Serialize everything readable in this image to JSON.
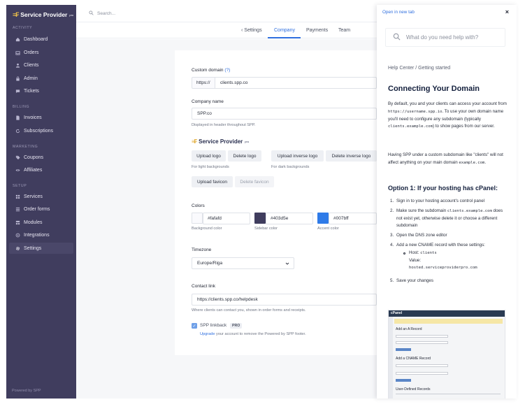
{
  "sidebar": {
    "brand": "Service Provider",
    "brand_mark": "≡₣",
    "brand_tm": "pro",
    "sections": [
      "ACTIVITY",
      "BILLING",
      "MARKETING",
      "SETUP"
    ],
    "items": [
      {
        "label": "Dashboard",
        "icon": "home-icon"
      },
      {
        "label": "Orders",
        "icon": "inbox-icon"
      },
      {
        "label": "Clients",
        "icon": "user-icon"
      },
      {
        "label": "Admin",
        "icon": "lock-icon"
      },
      {
        "label": "Tickets",
        "icon": "chat-icon"
      },
      {
        "label": "Invoices",
        "icon": "file-icon"
      },
      {
        "label": "Subscriptions",
        "icon": "refresh-icon"
      },
      {
        "label": "Coupons",
        "icon": "tag-icon"
      },
      {
        "label": "Affiliates",
        "icon": "eye-icon"
      },
      {
        "label": "Services",
        "icon": "grid-icon"
      },
      {
        "label": "Order forms",
        "icon": "list-icon"
      },
      {
        "label": "Modules",
        "icon": "modules-icon"
      },
      {
        "label": "Integrations",
        "icon": "plug-icon"
      },
      {
        "label": "Settings",
        "icon": "gear-icon"
      }
    ],
    "active": "Settings",
    "powered": "Powered by SPP"
  },
  "topbar": {
    "search_placeholder": "Search..."
  },
  "subnav": {
    "back": "‹ Settings",
    "tabs": [
      "Company",
      "Payments",
      "Team"
    ],
    "active": "Company"
  },
  "form": {
    "custom_domain_label": "Custom domain",
    "custom_domain_help": "(?)",
    "domain_prefix": "https://",
    "domain_value": "clients.spp.co",
    "company_name_label": "Company name",
    "company_name_value": "SPP.co",
    "company_name_hint": "Displayed in header throughout SPP.",
    "logo_preview_text": "Service Provider",
    "logo_preview_mark": "≡₣",
    "logo_preview_tm": "pro",
    "upload_logo": "Upload logo",
    "delete_logo": "Delete logo",
    "upload_inverse_logo": "Upload inverse logo",
    "delete_inverse_logo": "Delete inverse logo",
    "light_bg_hint": "For light backgrounds",
    "dark_bg_hint": "For dark backgrounds",
    "upload_favicon": "Upload favicon",
    "delete_favicon": "Delete favicon",
    "colors_label": "Colors",
    "background_color": "#fafafd",
    "background_color_label": "Background color",
    "sidebar_color": "#403d5e",
    "sidebar_color_label": "Sidebar color",
    "accent_color": "#007bff",
    "accent_color_label": "Accent color",
    "timezone_label": "Timezone",
    "timezone_value": "Europe/Riga",
    "contact_link_label": "Contact link",
    "contact_link_value": "https://clients.spp.co/helpdesk",
    "contact_link_hint": "Where clients can contact you, shown in order forms and receipts.",
    "linkback_label": "SPP linkback",
    "linkback_badge": "PRO",
    "linkback_upgrade": "Upgrade",
    "linkback_hint": " your account to remove the Powered by SPP footer."
  },
  "help": {
    "open_in_new_tab": "Open in new tab",
    "close": "×",
    "search_placeholder": "What do you need help with?",
    "breadcrumb": "Help Center  /  Getting started",
    "title": "Connecting Your Domain",
    "p1_a": "By default, you and your clients can access your account from ",
    "p1_code1": "https://username.spp.io",
    "p1_b": ". To use your own domain name you'll need to configure any subdomain (typically ",
    "p1_code2": "clients.example.com",
    "p1_c": ") to show pages from our server.",
    "p2_a": "Having SPP under a custom subdomain like \"clients\" will not affect anything on your main domain ",
    "p2_code": "example.com",
    "p2_b": ".",
    "option1": "Option 1: If your hosting has cPanel:",
    "step1": "Sign in to your hosting account's control panel",
    "step2_a": "Make sure the subdomain ",
    "step2_code": "clients.example.com",
    "step2_b": " does not exist yet, otherwise delete it or choose a different subdomain",
    "step3": "Open the DNS zone editor",
    "step4": "Add a new CNAME record with these settings:",
    "host_label": "Host: ",
    "host_value": "clients",
    "value_label": "Value:",
    "value_value": "hosted.serviceproviderpro.com",
    "step5": "Save your changes",
    "cpanel_brand": "cPanel",
    "cpanel_a": "Add an A Record",
    "cpanel_cname": "Add a CNAME Record",
    "cpanel_records": "User-Defined Records"
  },
  "colors": {
    "sidebar_bg": "#403d5e",
    "accent": "#2f6fdf",
    "brand_mark": "#f0c24a"
  }
}
